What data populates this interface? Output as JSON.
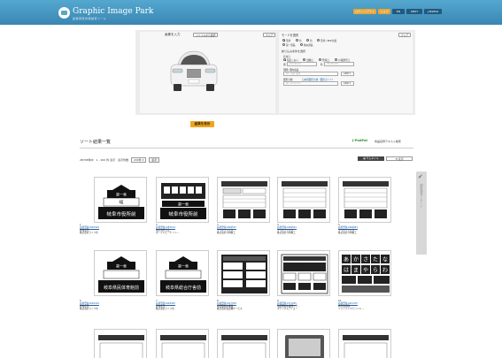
{
  "header": {
    "logo_title": "Graphic Image Park",
    "logo_sub": "画像意匠商標検索ツール",
    "buttons": [
      "ログイン/アウト",
      "ヘルプ",
      "EN",
      "SMST",
      "J-PlatPat"
    ]
  },
  "image_input": {
    "label": "画像を入力",
    "file_button": "ファイルから選択",
    "clear_button": "クリア"
  },
  "mode": {
    "label": "モードを選択",
    "clear_button": "クリア",
    "options_row1": [
      "形状",
      "色",
      "色",
      "形状＋BOF比較"
    ],
    "options_row2": [
      "第一部品",
      "類似部品"
    ]
  },
  "filters": {
    "heading": "絞り込み条件を選択",
    "date_label": "有効日",
    "date_options": [
      "指定しない",
      "出願日",
      "登録日",
      "公報発行日"
    ],
    "date_from_prefix": "期",
    "date_from_placeholder": "20140101",
    "date_to_prefix": "時",
    "date_to_placeholder": "20150101",
    "class_label": "国際/ 国内商品",
    "class_placeholder": "例）商標 陳域",
    "class_operator": "AND",
    "design_label": "図形分類",
    "design_link": "日本国図形分類（図形ガイド）",
    "design_placeholder": "例）07.07.07",
    "design_operator": "AND"
  },
  "show_button": "結果を表示",
  "results": {
    "title": "ソート結果一覧",
    "ubu_logo": "J-PlatPat",
    "ubu_text": "商品名称テキスト検索",
    "count_text": "28706件中　1 - 200 件 表示　表示件数",
    "per_page": "200件",
    "apply": "表示",
    "view_thumb": "サムネイル",
    "view_list": "表示",
    "side_tab": "図形検索アンケート"
  },
  "items": [
    {
      "num": "1",
      "link": "商標登録1049329",
      "l2": "建物名所",
      "l3": "株式会社ライフ市"
    },
    {
      "num": "2",
      "link": "商標登録1383124",
      "l2": "電子決済方法",
      "l3": "オープンビーク イン..."
    },
    {
      "num": "3",
      "link": "商標登録1408537",
      "l2": "ラベルプリンタ",
      "l3": "株式会社寺岡精工"
    },
    {
      "num": "4",
      "link": "商標登録1408561",
      "l2": "ラベルプリンタ",
      "l3": "株式会社寺岡精工"
    },
    {
      "num": "5",
      "link": "商標登録1408681",
      "l2": "ラベルプリンタ",
      "l3": "株式会社寺岡精工"
    },
    {
      "num": "6",
      "link": "商標登録1049334",
      "l2": "建物名所",
      "l3": "株式会社ライフ市"
    },
    {
      "num": "7",
      "link": "商標登録1049325",
      "l2": "建物名所",
      "l3": "株式会社ライフ市"
    },
    {
      "num": "8",
      "link": "商標登録1437076",
      "l2": "電話機端末機器",
      "l3": "株式会社電話機サービス"
    },
    {
      "num": "9",
      "link": "商標登録1371035",
      "l2": "電話機端末機器ンテ...",
      "l3": "マテックスアイエー"
    },
    {
      "num": "10",
      "link": "商標登録1401475",
      "l2": "携帯電話機",
      "l3": "ソフトバンクモバイル ..."
    }
  ],
  "thumb_texts": {
    "t1_top": "第一表",
    "t1_mid": "岐",
    "t1_bot": "岐阜市役所前",
    "t2_top": "第一表",
    "t2_bot": "岐阜市役所前",
    "t6_top": "第一表",
    "t6_bot": "岐阜県民体育館前",
    "t7_top": "第一表",
    "t7_bot": "岐阜県総合庁舎前",
    "t10": [
      "あ",
      "か",
      "さ",
      "た",
      "な",
      "は",
      "ま",
      "や",
      "ら",
      "わ"
    ]
  },
  "colors": {
    "header": "#3a86b2",
    "accent": "#f2a41a",
    "link": "#1c5fa8"
  }
}
